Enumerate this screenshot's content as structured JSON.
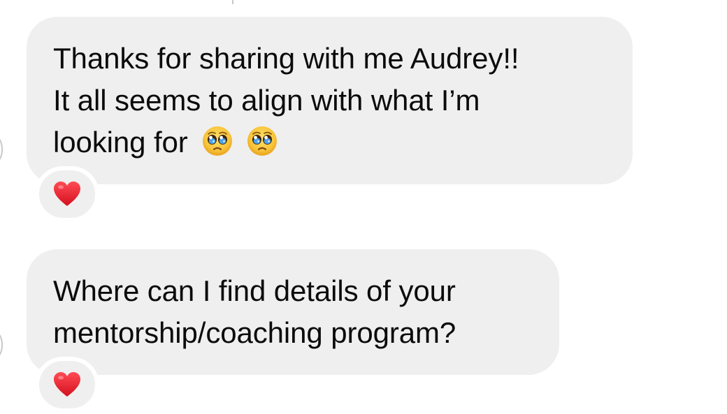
{
  "messages": [
    {
      "lines": [
        "Thanks for sharing with me Audrey!!",
        "It all seems to align with what I’m",
        "looking for"
      ],
      "emojis": [
        "pleading-face",
        "pleading-face"
      ],
      "reaction": "heart"
    },
    {
      "lines": [
        "Where can I find details of your",
        "mentorship/coaching program?"
      ],
      "emojis": [],
      "reaction": "heart"
    }
  ],
  "colors": {
    "bubble": "#efefef",
    "text": "#0b0b0b",
    "heart": "#e5202e",
    "background": "#ffffff"
  }
}
